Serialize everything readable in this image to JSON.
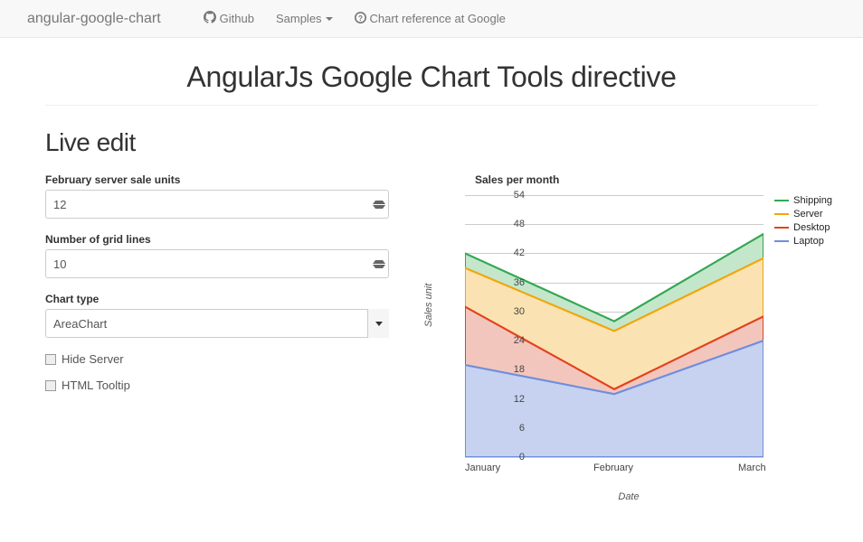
{
  "nav": {
    "brand": "angular-google-chart",
    "github": "Github",
    "samples": "Samples",
    "chartRef": "Chart reference at Google"
  },
  "page_title": "AngularJs Google Chart Tools directive",
  "section_title": "Live edit",
  "form": {
    "feb_label": "February server sale units",
    "feb_value": "12",
    "grid_label": "Number of grid lines",
    "grid_value": "10",
    "type_label": "Chart type",
    "type_value": "AreaChart",
    "hide_server": "Hide Server",
    "html_tooltip": "HTML Tooltip"
  },
  "legend": {
    "shipping": "Shipping",
    "server": "Server",
    "desktop": "Desktop",
    "laptop": "Laptop"
  },
  "chart_data": {
    "type": "area",
    "title": "Sales per month",
    "xlabel": "Date",
    "ylabel": "Sales unit",
    "ylim": [
      0,
      54
    ],
    "yticks": [
      0,
      6,
      12,
      18,
      24,
      30,
      36,
      42,
      48,
      54
    ],
    "categories": [
      "January",
      "February",
      "March"
    ],
    "series": [
      {
        "name": "Laptop",
        "values": [
          19,
          13,
          24
        ],
        "color": "#6f8edc"
      },
      {
        "name": "Desktop",
        "values": [
          31,
          14,
          29
        ],
        "color": "#e2431e"
      },
      {
        "name": "Server",
        "values": [
          39,
          26,
          41
        ],
        "color": "#f1a60a"
      },
      {
        "name": "Shipping",
        "values": [
          42,
          28,
          46
        ],
        "color": "#34a853"
      }
    ],
    "legend_position": "right",
    "stacked": false
  }
}
